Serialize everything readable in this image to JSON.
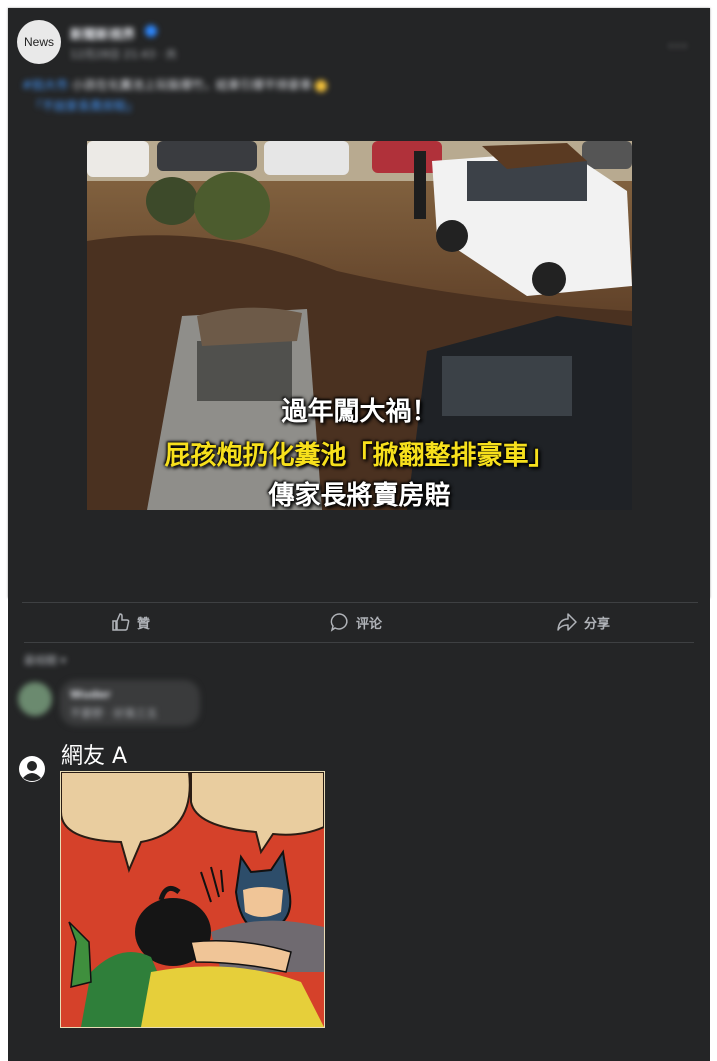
{
  "post": {
    "avatar_text": "News",
    "page_name": "新聞新視界",
    "meta": "12月28日 21:43 · 共",
    "more_label": "···",
    "caption_tag": "#拍大市",
    "caption_text": " 小孩在化糞池上玩裝爆竹，結果引爆平排豪車",
    "caption_link": "「不說家長賣房賠」"
  },
  "media": {
    "headline_1": "過年闖大禍！",
    "headline_2": "屁孩炮扔化糞池「掀翻整排豪車」",
    "headline_3": "傳家長將賣房賠"
  },
  "actions": {
    "like": "贊",
    "comment": "评论",
    "share": "分享"
  },
  "comments": {
    "sort_label": "最相關 ▾",
    "first_name": "Wuder",
    "first_text": "不要野 · 好臭三五",
    "reply_user": "網友 A"
  },
  "colors": {
    "card_bg": "#242526",
    "accent_blue": "#2d88ff",
    "headline_yellow": "#f7e01c"
  }
}
